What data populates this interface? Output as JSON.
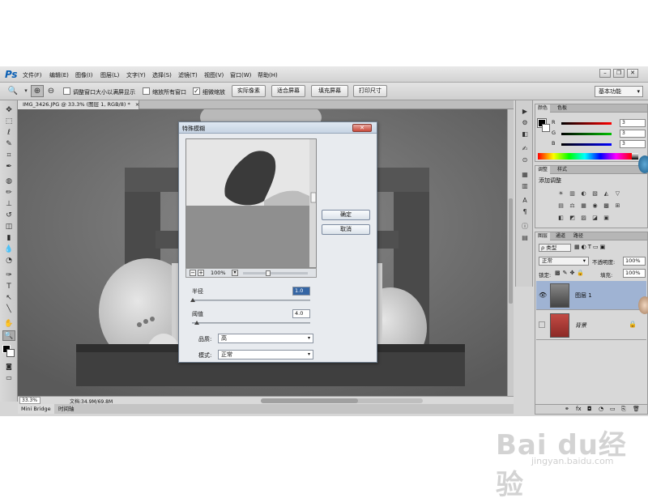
{
  "app": {
    "logo": "Ps"
  },
  "menu": [
    "文件(F)",
    "编辑(E)",
    "图像(I)",
    "图层(L)",
    "文字(Y)",
    "选择(S)",
    "滤镜(T)",
    "视图(V)",
    "窗口(W)",
    "帮助(H)"
  ],
  "window_controls": {
    "minimize": "–",
    "restore": "❐",
    "close": "✕"
  },
  "options": {
    "resize_windows": "调整窗口大小以满屏显示",
    "zoom_all": "缩放所有窗口",
    "scrubby_zoom": "细微缩放",
    "resize_checked": false,
    "zoom_all_checked": false,
    "scrubby_checked": true,
    "actual_pixels": "实际像素",
    "fit_screen": "适合屏幕",
    "fill_screen": "填充屏幕",
    "print_size": "打印尺寸",
    "workspace": "基本功能"
  },
  "document": {
    "tab_title": "IMG_3426.JPG @ 33.3% (图层 1, RGB/8) *",
    "tab_close": "×",
    "zoom": "33.3%",
    "doc_size": "文档:34.9M/69.8M"
  },
  "bottom_tabs": [
    "Mini Bridge",
    "时间轴"
  ],
  "dialog": {
    "title": "特殊模糊",
    "ok": "确定",
    "cancel": "取消",
    "preview_zoom": "100%",
    "zoom_in": "+",
    "zoom_out": "−",
    "radius_label": "半径",
    "radius_value": "1.0",
    "radius_level": 0.01,
    "threshold_label": "阈值",
    "threshold_value": "4.0",
    "threshold_level": 0.04,
    "quality_label": "品质:",
    "quality_value": "高",
    "mode_label": "模式:",
    "mode_value": "正常"
  },
  "color_panel": {
    "tabs": [
      "颜色",
      "色板"
    ],
    "channels": [
      {
        "name": "R",
        "value": "3",
        "color": "#cc2a2a"
      },
      {
        "name": "G",
        "value": "3",
        "color": "#2a9a2a"
      },
      {
        "name": "B",
        "value": "3",
        "color": "#2a3acc"
      }
    ]
  },
  "adjust_panel": {
    "tabs": [
      "调整",
      "样式"
    ],
    "title": "添加调整",
    "icons_row1": [
      "☀",
      "▥",
      "◐",
      "▧",
      "◭",
      "▽"
    ],
    "icons_row2": [
      "▤",
      "⚖",
      "▦",
      "◉",
      "▩",
      "⊞"
    ],
    "icons_row3": [
      "◧",
      "◩",
      "▨",
      "◪",
      "▣"
    ]
  },
  "layers_panel": {
    "tabs": [
      "图层",
      "通道",
      "路径"
    ],
    "filter_kind": "类型",
    "blend_mode": "正常",
    "opacity_label": "不透明度:",
    "opacity_value": "100%",
    "lock_label": "锁定:",
    "fill_label": "填充:",
    "fill_value": "100%",
    "layers": [
      {
        "name": "图层 1",
        "visible": true,
        "selected": true
      },
      {
        "name": "背景",
        "visible": false,
        "selected": false,
        "locked": true
      }
    ],
    "footer_icons": [
      "⚭",
      "fx",
      "◘",
      "◔",
      "▭",
      "⎘",
      "🗑"
    ]
  },
  "watermark": {
    "brand": "Bai du经验",
    "url": "jingyan.baidu.com"
  }
}
